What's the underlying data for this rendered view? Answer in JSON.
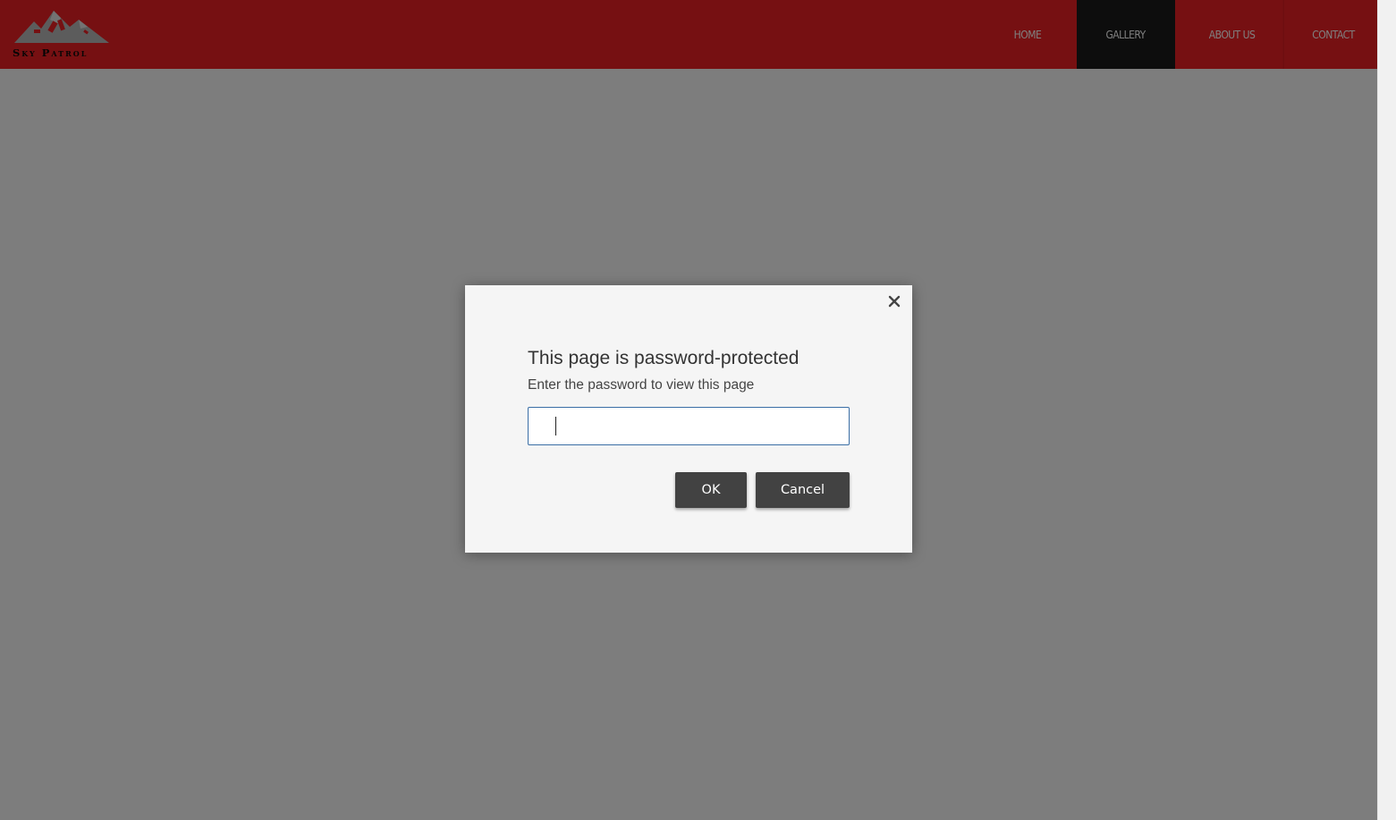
{
  "site": {
    "logo_text": "Sky Patrol",
    "brand_color": "#ed2024"
  },
  "nav": {
    "items": [
      {
        "label": "HOME"
      },
      {
        "label": "GALLERY",
        "active": true
      },
      {
        "label": "ABOUT US"
      },
      {
        "label": "CONTACT"
      }
    ]
  },
  "dialog": {
    "title": "This page is password-protected",
    "subtitle": "Enter the password to view this page",
    "password_value": "",
    "ok_label": "OK",
    "cancel_label": "Cancel",
    "close_icon": "close-icon"
  }
}
